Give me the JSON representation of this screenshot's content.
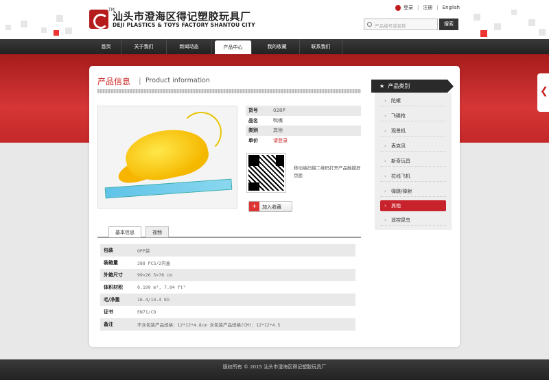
{
  "brand": {
    "tm": "TM",
    "name_cn": "汕头市澄海区得记塑胶玩具厂",
    "name_en": "DEJI PLASTICS & TOYS FACTORY SHANTOU CITY"
  },
  "toplinks": {
    "login": "登录",
    "register": "注册",
    "language": "English"
  },
  "search": {
    "placeholder": "产品编号或名称",
    "button": "搜索"
  },
  "nav": [
    {
      "label": "首页",
      "active": false
    },
    {
      "label": "关于我们",
      "active": false
    },
    {
      "label": "新闻动态",
      "active": false
    },
    {
      "label": "产品中心",
      "active": true
    },
    {
      "label": "我的收藏",
      "active": false
    },
    {
      "label": "联系我们",
      "active": false
    }
  ],
  "page": {
    "title_cn": "产品信息",
    "separator": "|",
    "title_en": "Product information"
  },
  "product": {
    "spec": [
      {
        "key": "货号",
        "value": "028P"
      },
      {
        "key": "品名",
        "value": "鸭嘴"
      },
      {
        "key": "类别",
        "value": "其他"
      },
      {
        "key": "单价",
        "value": "请登录"
      }
    ],
    "qr_text": "移动端扫描二维码打开产品触摸屏页面",
    "favorite": "加入收藏"
  },
  "tabs": [
    {
      "label": "基本信息",
      "active": true
    },
    {
      "label": "视频",
      "active": false
    }
  ],
  "details": [
    {
      "key": "包装",
      "value": "OPP袋"
    },
    {
      "key": "装箱量",
      "value": "288 PCS/2内盒"
    },
    {
      "key": "外箱尺寸",
      "value": "99×26.5×76 cm"
    },
    {
      "key": "体积材积",
      "value": "0.199 m³, 7.04 ft³"
    },
    {
      "key": "毛/净重",
      "value": "16.4/14.4 KG"
    },
    {
      "key": "证书",
      "value": "EN71/CD"
    },
    {
      "key": "备注",
      "value": "不含包装产品规格：12*12*4.8cm 含包装产品规格(CM)：12*12*4.5"
    }
  ],
  "categories": {
    "title": "产品类别",
    "items": [
      {
        "label": "陀螺",
        "active": false
      },
      {
        "label": "飞碟枪",
        "active": false
      },
      {
        "label": "观景机",
        "active": false
      },
      {
        "label": "表克风",
        "active": false
      },
      {
        "label": "新奇玩具",
        "active": false
      },
      {
        "label": "拉线飞机",
        "active": false
      },
      {
        "label": "弹跳/弹射",
        "active": false
      },
      {
        "label": "其他",
        "active": true
      },
      {
        "label": "遥控昆虫",
        "active": false
      }
    ]
  },
  "footer": "版权所有 © 2015 汕头市澄海区得记塑胶玩具厂",
  "colors": {
    "accent": "#c8232c",
    "nav": "#2a2a2a",
    "band": "#c42828"
  }
}
